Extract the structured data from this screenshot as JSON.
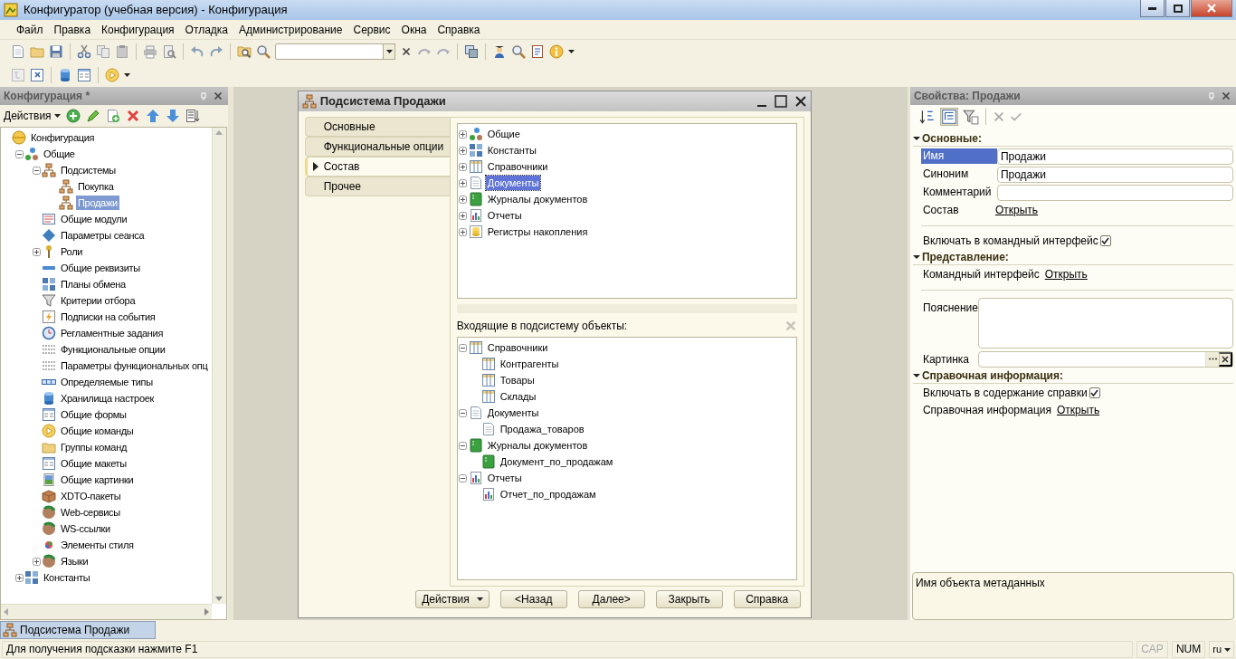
{
  "window": {
    "title": "Конфигуратор (учебная версия) - Конфигурация"
  },
  "menu": [
    "Файл",
    "Правка",
    "Конфигурация",
    "Отладка",
    "Администрирование",
    "Сервис",
    "Окна",
    "Справка"
  ],
  "config_panel": {
    "title": "Конфигурация *",
    "actions_label": "Действия",
    "tree": [
      {
        "label": "Конфигурация",
        "selected": false,
        "children": [
          {
            "label": "Общие",
            "selected": false,
            "expanded": true,
            "children": [
              {
                "label": "Подсистемы",
                "selected": false,
                "expanded": true,
                "children": [
                  {
                    "label": "Покупка",
                    "selected": false
                  },
                  {
                    "label": "Продажи",
                    "selected": true
                  }
                ]
              },
              {
                "label": "Общие модули",
                "selected": false
              },
              {
                "label": "Параметры сеанса",
                "selected": false
              },
              {
                "label": "Роли",
                "selected": false,
                "expanded": false
              },
              {
                "label": "Общие реквизиты",
                "selected": false
              },
              {
                "label": "Планы обмена",
                "selected": false
              },
              {
                "label": "Критерии отбора",
                "selected": false
              },
              {
                "label": "Подписки на события",
                "selected": false
              },
              {
                "label": "Регламентные задания",
                "selected": false
              },
              {
                "label": "Функциональные опции",
                "selected": false
              },
              {
                "label": "Параметры функциональных опц",
                "selected": false
              },
              {
                "label": "Определяемые типы",
                "selected": false
              },
              {
                "label": "Хранилища настроек",
                "selected": false
              },
              {
                "label": "Общие формы",
                "selected": false
              },
              {
                "label": "Общие команды",
                "selected": false
              },
              {
                "label": "Группы команд",
                "selected": false
              },
              {
                "label": "Общие макеты",
                "selected": false
              },
              {
                "label": "Общие картинки",
                "selected": false
              },
              {
                "label": "XDTO-пакеты",
                "selected": false
              },
              {
                "label": "Web-сервисы",
                "selected": false
              },
              {
                "label": "WS-ссылки",
                "selected": false
              },
              {
                "label": "Элементы стиля",
                "selected": false
              },
              {
                "label": "Языки",
                "selected": false,
                "expanded": false
              }
            ]
          },
          {
            "label": "Константы",
            "selected": false,
            "expanded": false
          }
        ]
      }
    ]
  },
  "dialog": {
    "title": "Подсистема Продажи",
    "tabs": [
      {
        "label": "Основные",
        "selected": false
      },
      {
        "label": "Функциональные опции",
        "selected": false
      },
      {
        "label": "Состав",
        "selected": true
      },
      {
        "label": "Прочее",
        "selected": false
      }
    ],
    "available_tree": [
      {
        "label": "Общие",
        "selected": false,
        "expanded": false
      },
      {
        "label": "Константы",
        "selected": false,
        "expanded": false
      },
      {
        "label": "Справочники",
        "selected": false,
        "expanded": false
      },
      {
        "label": "Документы",
        "selected": true,
        "expanded": false
      },
      {
        "label": "Журналы документов",
        "selected": false,
        "expanded": false
      },
      {
        "label": "Отчеты",
        "selected": false,
        "expanded": false
      },
      {
        "label": "Регистры накопления",
        "selected": false,
        "expanded": false
      }
    ],
    "included_label": "Входящие в подсистему объекты:",
    "included_tree": [
      {
        "label": "Справочники",
        "expanded": true,
        "children": [
          {
            "label": "Контрагенты"
          },
          {
            "label": "Товары"
          },
          {
            "label": "Склады"
          }
        ]
      },
      {
        "label": "Документы",
        "expanded": true,
        "children": [
          {
            "label": "Продажа_товаров"
          }
        ]
      },
      {
        "label": "Журналы документов",
        "expanded": true,
        "children": [
          {
            "label": "Документ_по_продажам"
          }
        ]
      },
      {
        "label": "Отчеты",
        "expanded": true,
        "children": [
          {
            "label": "Отчет_по_продажам"
          }
        ]
      }
    ],
    "buttons": [
      {
        "label": "Действия",
        "kind": "menu"
      },
      {
        "label": "<Назад",
        "kind": "plain"
      },
      {
        "label": "Далее>",
        "kind": "plain"
      },
      {
        "label": "Закрыть",
        "kind": "plain"
      },
      {
        "label": "Справка",
        "kind": "plain"
      }
    ]
  },
  "properties": {
    "title": "Свойства: Продажи",
    "sections": [
      {
        "title": "Основные:",
        "expanded": true,
        "rows": [
          {
            "kind": "field",
            "label": "Имя",
            "value": "Продажи",
            "selected": true
          },
          {
            "kind": "field",
            "label": "Синоним",
            "value": "Продажи",
            "selected": false
          },
          {
            "kind": "field",
            "label": "Комментарий",
            "selected": false
          },
          {
            "kind": "link",
            "label": "Состав",
            "link": "Открыть"
          },
          {
            "kind": "separator"
          },
          {
            "kind": "checkbox",
            "label": "Включать в командный интерфейс",
            "checked": true
          }
        ]
      },
      {
        "title": "Представление:",
        "expanded": true,
        "rows": [
          {
            "kind": "link",
            "label": "Командный интерфейс",
            "link": "Открыть"
          },
          {
            "kind": "separator"
          },
          {
            "kind": "textarea",
            "label": "Пояснение"
          },
          {
            "kind": "picker",
            "label": "Картинка"
          }
        ]
      },
      {
        "title": "Справочная информация:",
        "expanded": true,
        "rows": [
          {
            "kind": "checkbox",
            "label": "Включать в содержание справки",
            "checked": true
          },
          {
            "kind": "link",
            "label": "Справочная информация",
            "link": "Открыть"
          }
        ]
      }
    ],
    "hint": "Имя объекта метаданных"
  },
  "taskbar": [
    {
      "label": "Подсистема Продажи",
      "selected": true
    }
  ],
  "status_bar": {
    "message": "Для получения подсказки нажмите F1",
    "indicators": [
      {
        "label": "CAP",
        "on": false
      },
      {
        "label": "NUM",
        "on": true
      }
    ],
    "language": "ru"
  }
}
